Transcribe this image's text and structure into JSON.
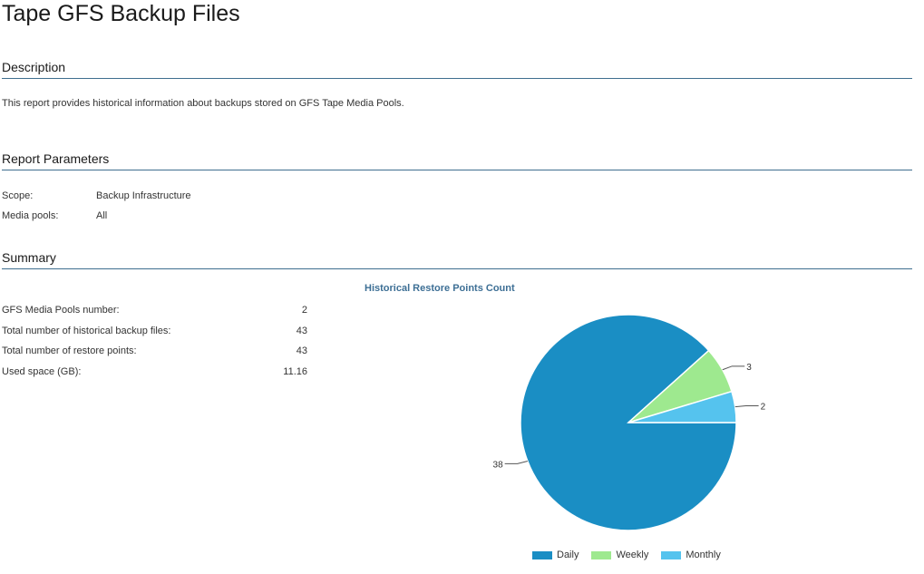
{
  "page": {
    "title": "Tape GFS Backup Files"
  },
  "description": {
    "heading": "Description",
    "text": "This report provides historical information about backups stored on GFS Tape Media Pools."
  },
  "parameters": {
    "heading": "Report Parameters",
    "rows": [
      {
        "label": "Scope:",
        "value": "Backup Infrastructure"
      },
      {
        "label": "Media pools:",
        "value": "All"
      }
    ]
  },
  "summary": {
    "heading": "Summary",
    "rows": [
      {
        "label": "GFS Media Pools number:",
        "value": "2"
      },
      {
        "label": "Total number of historical backup files:",
        "value": "43"
      },
      {
        "label": "Total number of restore points:",
        "value": "43"
      },
      {
        "label": "Used space (GB):",
        "value": "11.16"
      }
    ]
  },
  "chart_data": {
    "type": "pie",
    "title": "Historical Restore Points Count",
    "categories": [
      "Daily",
      "Weekly",
      "Monthly"
    ],
    "values": [
      38,
      3,
      2
    ],
    "colors": [
      "#1a8ec4",
      "#9ee98f",
      "#55c3ee"
    ],
    "legend": "bottom"
  }
}
